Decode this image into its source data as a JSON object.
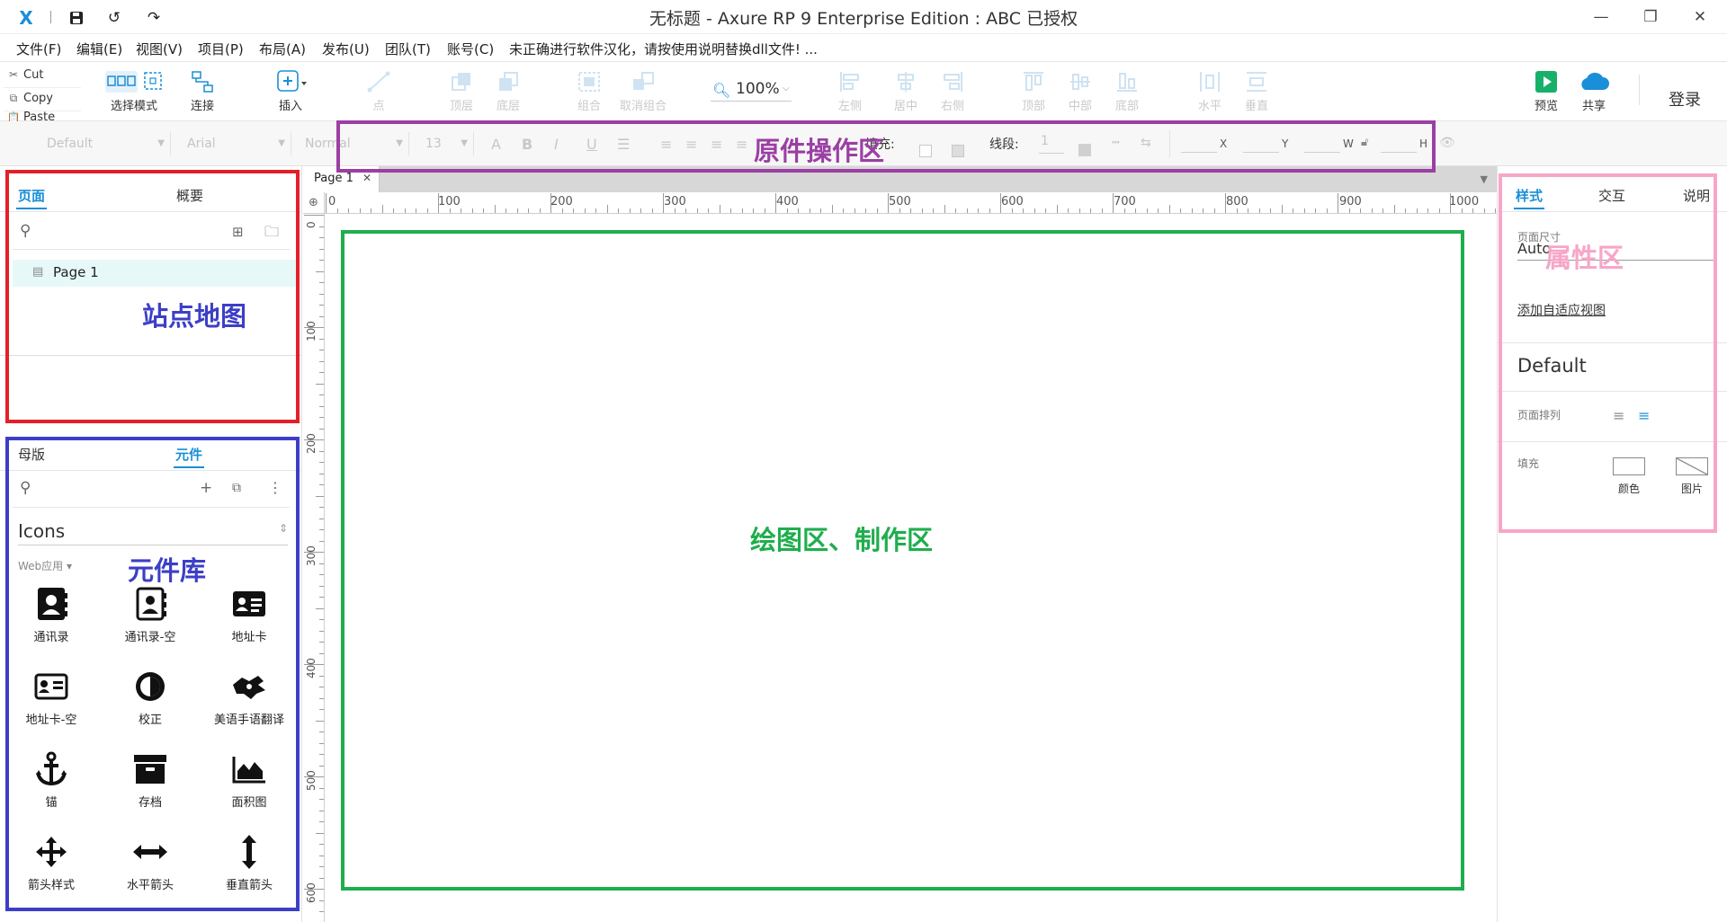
{
  "window": {
    "title": "无标题 - Axure RP 9 Enterprise Edition : ABC 已授权"
  },
  "menu": [
    "文件(F)",
    "编辑(E)",
    "视图(V)",
    "项目(P)",
    "布局(A)",
    "发布(U)",
    "团队(T)",
    "账号(C)",
    "未正确进行软件汉化，请按使用说明替换dll文件! ..."
  ],
  "clipboard": {
    "cut": "Cut",
    "copy": "Copy",
    "paste": "Paste"
  },
  "toolbar": {
    "select_mode": "选择模式",
    "connect": "连接",
    "insert": "插入",
    "point": "点",
    "top_layer": "顶层",
    "bottom_layer": "底层",
    "group": "组合",
    "ungroup": "取消组合",
    "zoom": "100%",
    "align_left": "左侧",
    "align_center": "居中",
    "align_right": "右侧",
    "align_top": "顶部",
    "align_middle": "中部",
    "align_bottom": "底部",
    "horizontal": "水平",
    "vertical": "垂直",
    "preview": "预览",
    "share": "共享",
    "login": "登录"
  },
  "formatbar": {
    "style": "Default",
    "font": "Arial",
    "weight": "Normal",
    "size": "13",
    "fill_label": "填充:",
    "line_label": "线段:",
    "line_value": "1",
    "x": "X",
    "y": "Y",
    "w": "W",
    "h": "H"
  },
  "pages_panel": {
    "tab_pages": "页面",
    "tab_outline": "概要",
    "pages": [
      "Page 1"
    ]
  },
  "widgets_panel": {
    "tab_masters": "母版",
    "tab_widgets": "元件",
    "library": "Icons",
    "category": "Web应用 ▾",
    "items": [
      {
        "label": "通讯录",
        "icon": "contact-book-icon"
      },
      {
        "label": "通讯录-空",
        "icon": "contact-book-outline-icon"
      },
      {
        "label": "地址卡",
        "icon": "address-card-icon"
      },
      {
        "label": "地址卡-空",
        "icon": "address-card-outline-icon"
      },
      {
        "label": "校正",
        "icon": "adjust-icon"
      },
      {
        "label": "美语手语翻译",
        "icon": "sign-language-icon"
      },
      {
        "label": "锚",
        "icon": "anchor-icon"
      },
      {
        "label": "存档",
        "icon": "archive-icon"
      },
      {
        "label": "面积图",
        "icon": "area-chart-icon"
      },
      {
        "label": "箭头样式",
        "icon": "arrows-icon"
      },
      {
        "label": "水平箭头",
        "icon": "arrows-horizontal-icon"
      },
      {
        "label": "垂直箭头",
        "icon": "arrows-vertical-icon"
      }
    ]
  },
  "canvas": {
    "page_tab": "Page 1",
    "ruler_top": [
      "0",
      "100",
      "200",
      "300",
      "400",
      "500",
      "600",
      "700",
      "800",
      "900",
      "1000"
    ],
    "ruler_left": [
      "0",
      "100",
      "200",
      "300",
      "400",
      "500",
      "600"
    ]
  },
  "inspector": {
    "tab_style": "样式",
    "tab_interaction": "交互",
    "tab_notes": "说明",
    "page_size_label": "页面尺寸",
    "page_size_value": "Auto",
    "adaptive_link": "添加自适应视图",
    "style_name": "Default",
    "page_align_label": "页面排列",
    "fill_label": "填充",
    "fill_color": "颜色",
    "fill_image": "图片"
  },
  "annotations": {
    "toolbar_area": "原件操作区",
    "sitemap_area": "站点地图",
    "library_area": "元件库",
    "canvas_area": "绘图区、制作区",
    "property_area": "属性区"
  },
  "colors": {
    "accent": "#1a8ed8",
    "annot_purple": "#9b3fa3",
    "annot_red": "#e3202a",
    "annot_blue": "#3c3fc6",
    "annot_green": "#1fae4d",
    "annot_pink": "#f7a6c8"
  }
}
